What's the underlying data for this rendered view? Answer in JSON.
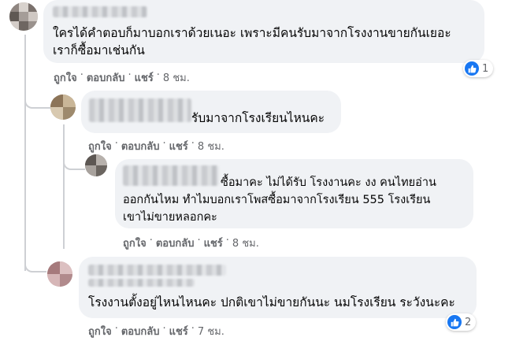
{
  "colors": {
    "accent": "#1877f2",
    "bubble": "#f0f2f5",
    "meta": "#65676b"
  },
  "comments": [
    {
      "lines": [
        "ใครได้คำตอบก็มาบอกเราด้วยเนอะ เพราะมีคนรับมาจากโรงงานขายกันเยอะ",
        "เราก็ซื้อมาเช่นกัน"
      ],
      "like": "ถูกใจ",
      "reply": "ตอบกลับ",
      "share": "แชร์",
      "time": "8 ชม.",
      "reaction_icon": "like-icon",
      "reaction_count": "1"
    },
    {
      "lines": [
        "รับมาจากโรงเรียนไหนคะ"
      ],
      "like": "ถูกใจ",
      "reply": "ตอบกลับ",
      "share": "แชร์",
      "time": "8 ชม."
    },
    {
      "lines": [
        "ซื้อมาคะ ไม่ได้รับ โรงงานคะ งง คนไทยอ่าน",
        "ออกกันไหม ทำไมบอกเราโพสซื้อมาจากโรงเรียน 555 โรงเรียน",
        "เขาไม่ขายหลอกคะ"
      ],
      "like": "ถูกใจ",
      "reply": "ตอบกลับ",
      "share": "แชร์",
      "time": "8 ชม."
    },
    {
      "lines": [
        "โรงงานตั้งอยู่ไหนไหนคะ ปกติเขาไม่ขายกันนะ นมโรงเรียน ระวังนะคะ"
      ],
      "like": "ถูกใจ",
      "reply": "ตอบกลับ",
      "share": "แชร์",
      "time": "7 ชม.",
      "reaction_icon": "like-icon",
      "reaction_count": "2"
    }
  ]
}
